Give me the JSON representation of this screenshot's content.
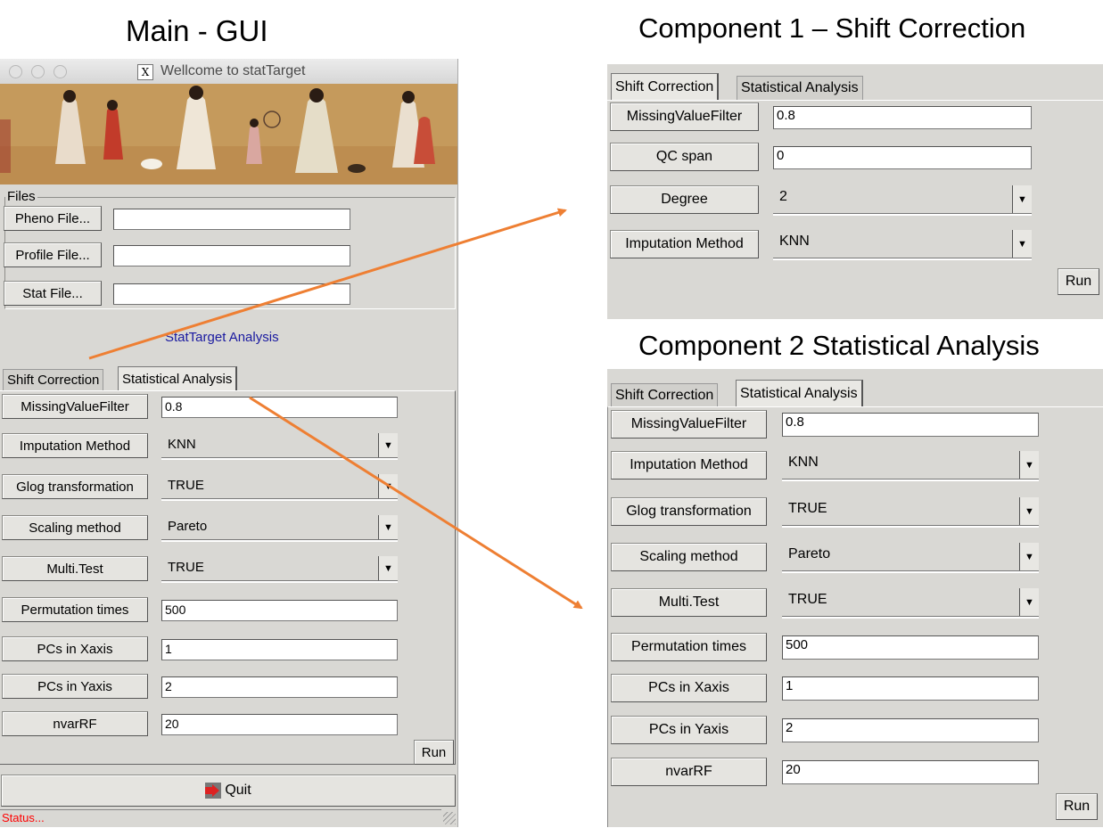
{
  "headings": {
    "main": "Main - GUI",
    "component1": "Component  1 – Shift Correction",
    "component2": "Component  2 Statistical Analysis"
  },
  "main_gui": {
    "window_title": "Wellcome to statTarget",
    "files_group_label": "Files",
    "file_rows": [
      {
        "button": "Pheno File...",
        "value": ""
      },
      {
        "button": "Profile File...",
        "value": ""
      },
      {
        "button": "Stat File...",
        "value": ""
      }
    ],
    "analysis_label": "StatTarget Analysis",
    "tabs": [
      "Shift Correction",
      "Statistical Analysis"
    ],
    "active_tab": "Statistical Analysis",
    "params": [
      {
        "label": "MissingValueFilter",
        "value": "0.8",
        "kind": "entry"
      },
      {
        "label": "Imputation Method",
        "value": "KNN",
        "kind": "combo"
      },
      {
        "label": "Glog transformation",
        "value": "TRUE",
        "kind": "combo"
      },
      {
        "label": "Scaling method",
        "value": "Pareto",
        "kind": "combo"
      },
      {
        "label": "Multi.Test",
        "value": "TRUE",
        "kind": "combo"
      },
      {
        "label": "Permutation times",
        "value": "500",
        "kind": "entry"
      },
      {
        "label": "PCs in Xaxis",
        "value": "1",
        "kind": "entry"
      },
      {
        "label": "PCs in Yaxis",
        "value": "2",
        "kind": "entry"
      },
      {
        "label": "nvarRF",
        "value": "20",
        "kind": "entry"
      }
    ],
    "run_label": "Run",
    "quit_label": "Quit",
    "status_text": "Status..."
  },
  "component1": {
    "tabs": [
      "Shift Correction",
      "Statistical Analysis"
    ],
    "active_tab": "Shift Correction",
    "params": [
      {
        "label": "MissingValueFilter",
        "value": "0.8",
        "kind": "entry"
      },
      {
        "label": "QC span",
        "value": "0",
        "kind": "entry"
      },
      {
        "label": "Degree",
        "value": "2",
        "kind": "combo"
      },
      {
        "label": "Imputation Method",
        "value": "KNN",
        "kind": "combo"
      }
    ],
    "run_label": "Run"
  },
  "component2": {
    "tabs": [
      "Shift Correction",
      "Statistical Analysis"
    ],
    "active_tab": "Statistical Analysis",
    "params": [
      {
        "label": "MissingValueFilter",
        "value": "0.8",
        "kind": "entry"
      },
      {
        "label": "Imputation Method",
        "value": "KNN",
        "kind": "combo"
      },
      {
        "label": "Glog transformation",
        "value": "TRUE",
        "kind": "combo"
      },
      {
        "label": "Scaling method",
        "value": "Pareto",
        "kind": "combo"
      },
      {
        "label": "Multi.Test",
        "value": "TRUE",
        "kind": "combo"
      },
      {
        "label": "Permutation times",
        "value": "500",
        "kind": "entry"
      },
      {
        "label": "PCs in Xaxis",
        "value": "1",
        "kind": "entry"
      },
      {
        "label": "PCs in Yaxis",
        "value": "2",
        "kind": "entry"
      },
      {
        "label": "nvarRF",
        "value": "20",
        "kind": "entry"
      }
    ],
    "run_label": "Run"
  },
  "colors": {
    "panel": "#d9d8d4",
    "arrow": "#ee7f33",
    "analysis_label": "#1a1aa0",
    "status": "#ff0000"
  }
}
